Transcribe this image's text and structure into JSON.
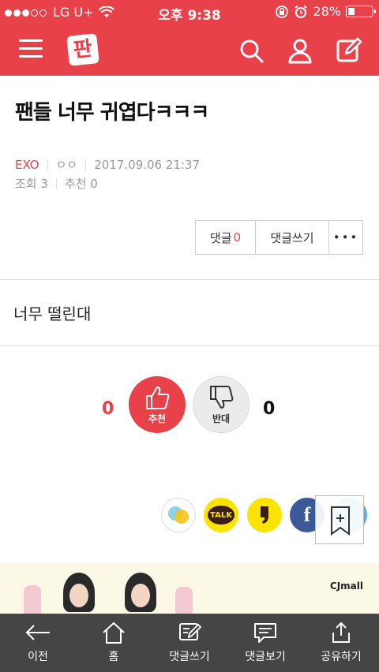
{
  "status_bar": {
    "carrier": "LG U+",
    "time": "오후 9:38",
    "battery": "28%",
    "battery_level": 0.28
  },
  "header": {
    "logo_text": "판"
  },
  "article": {
    "title": "팬들 너무 귀엽다ㅋㅋㅋ",
    "category": "EXO",
    "author": "ㅇㅇ",
    "datetime": "2017.09.06 21:37",
    "views": "조회 3",
    "recommend": "추천 0",
    "body": "너무 떨린대"
  },
  "actions": {
    "comment_label": "댓글",
    "comment_count": "0",
    "write_comment": "댓글쓰기",
    "more": "•••"
  },
  "vote": {
    "up_count": "0",
    "up_label": "추천",
    "down_label": "반대",
    "down_count": "0"
  },
  "share": {
    "kakaotalk_label": "TALK",
    "facebook_label": "f"
  },
  "banner": {
    "brand": "CJmall"
  },
  "bottom_nav": [
    {
      "label": "이전",
      "icon": "back-arrow-icon"
    },
    {
      "label": "홈",
      "icon": "home-icon"
    },
    {
      "label": "댓글쓰기",
      "icon": "write-comment-icon"
    },
    {
      "label": "댓글보기",
      "icon": "view-comments-icon"
    },
    {
      "label": "공유하기",
      "icon": "share-icon"
    }
  ],
  "colors": {
    "brand_red": "#e8414a",
    "bottom_bar": "#454545",
    "kakao_yellow": "#fbe300",
    "facebook_blue": "#3b5998"
  }
}
